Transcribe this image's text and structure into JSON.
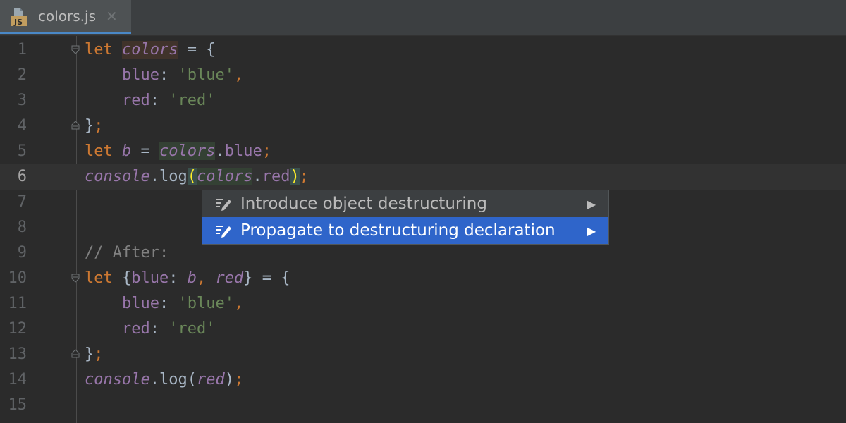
{
  "tab": {
    "title": "colors.js",
    "close": "✕",
    "icon": "js-file-icon",
    "icon_label": "JS"
  },
  "editor": {
    "current_line": 6,
    "lines": [
      {
        "n": "1",
        "tokens": [
          {
            "t": "let ",
            "c": "kw"
          },
          {
            "t": "colors",
            "c": "var hl-write"
          },
          {
            "t": " = {",
            "c": "plain"
          }
        ]
      },
      {
        "n": "2",
        "tokens": [
          {
            "t": "    blue",
            "c": "prop"
          },
          {
            "t": ": ",
            "c": "plain"
          },
          {
            "t": "'blue'",
            "c": "str"
          },
          {
            "t": ",",
            "c": "kw"
          }
        ]
      },
      {
        "n": "3",
        "tokens": [
          {
            "t": "    red",
            "c": "prop"
          },
          {
            "t": ": ",
            "c": "plain"
          },
          {
            "t": "'red'",
            "c": "str"
          }
        ]
      },
      {
        "n": "4",
        "tokens": [
          {
            "t": "}",
            "c": "plain"
          },
          {
            "t": ";",
            "c": "kw"
          }
        ]
      },
      {
        "n": "5",
        "tokens": [
          {
            "t": "let ",
            "c": "kw"
          },
          {
            "t": "b",
            "c": "var"
          },
          {
            "t": " = ",
            "c": "plain"
          },
          {
            "t": "colors",
            "c": "var hl-read"
          },
          {
            "t": ".",
            "c": "plain"
          },
          {
            "t": "blue",
            "c": "prop"
          },
          {
            "t": ";",
            "c": "kw"
          }
        ]
      },
      {
        "n": "6",
        "tokens": [
          {
            "t": "console",
            "c": "gvar"
          },
          {
            "t": ".",
            "c": "plain"
          },
          {
            "t": "log",
            "c": "fn"
          },
          {
            "t": "(",
            "c": "hl-brace"
          },
          {
            "t": "colors",
            "c": "var hl-read"
          },
          {
            "t": ".",
            "c": "plain"
          },
          {
            "t": "red",
            "c": "prop"
          },
          {
            "t": ")",
            "c": "hl-brace"
          },
          {
            "t": ";",
            "c": "kw"
          }
        ]
      },
      {
        "n": "7",
        "tokens": []
      },
      {
        "n": "8",
        "tokens": []
      },
      {
        "n": "9",
        "tokens": [
          {
            "t": "// After:",
            "c": "cmt"
          }
        ]
      },
      {
        "n": "10",
        "tokens": [
          {
            "t": "let ",
            "c": "kw"
          },
          {
            "t": "{",
            "c": "plain"
          },
          {
            "t": "blue",
            "c": "prop"
          },
          {
            "t": ": ",
            "c": "plain"
          },
          {
            "t": "b",
            "c": "var"
          },
          {
            "t": ", ",
            "c": "kw"
          },
          {
            "t": "red",
            "c": "var"
          },
          {
            "t": "} = {",
            "c": "plain"
          }
        ]
      },
      {
        "n": "11",
        "tokens": [
          {
            "t": "    blue",
            "c": "prop"
          },
          {
            "t": ": ",
            "c": "plain"
          },
          {
            "t": "'blue'",
            "c": "str"
          },
          {
            "t": ",",
            "c": "kw"
          }
        ]
      },
      {
        "n": "12",
        "tokens": [
          {
            "t": "    red",
            "c": "prop"
          },
          {
            "t": ": ",
            "c": "plain"
          },
          {
            "t": "'red'",
            "c": "str"
          }
        ]
      },
      {
        "n": "13",
        "tokens": [
          {
            "t": "}",
            "c": "plain"
          },
          {
            "t": ";",
            "c": "kw"
          }
        ]
      },
      {
        "n": "14",
        "tokens": [
          {
            "t": "console",
            "c": "gvar"
          },
          {
            "t": ".",
            "c": "plain"
          },
          {
            "t": "log",
            "c": "fn"
          },
          {
            "t": "(",
            "c": "plain"
          },
          {
            "t": "red",
            "c": "var"
          },
          {
            "t": ")",
            "c": "plain"
          },
          {
            "t": ";",
            "c": "kw"
          }
        ]
      },
      {
        "n": "15",
        "tokens": []
      }
    ],
    "fold_markers": [
      {
        "line": 1,
        "type": "open"
      },
      {
        "line": 4,
        "type": "close"
      },
      {
        "line": 10,
        "type": "open"
      },
      {
        "line": 13,
        "type": "close"
      }
    ]
  },
  "popup": {
    "items": [
      {
        "label": "Introduce object destructuring",
        "icon": "intention-icon",
        "arrow": "▶",
        "selected": false
      },
      {
        "label": "Propagate to destructuring declaration",
        "icon": "intention-icon",
        "arrow": "▶",
        "selected": true
      }
    ]
  },
  "colors": {
    "accent": "#2f65ca",
    "keyword": "#cc7832",
    "variable": "#9876aa",
    "string": "#6a8759",
    "comment": "#808080",
    "background": "#2b2b2b"
  }
}
